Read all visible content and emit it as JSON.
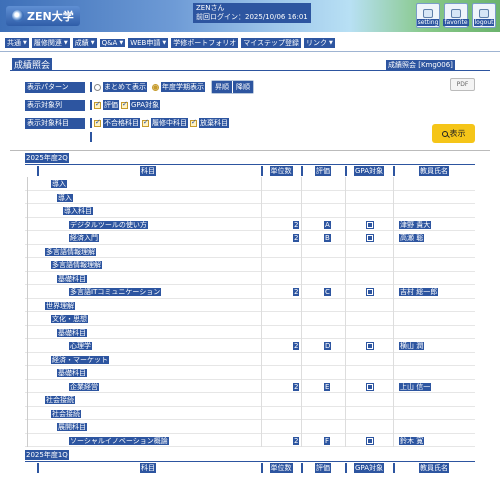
{
  "header": {
    "logo_text": "ZEN大学",
    "user_name": "ZENさん",
    "last_login": "前回ログイン：2025/10/06 16:01",
    "buttons": [
      {
        "label": "setting",
        "icon": "gear-icon"
      },
      {
        "label": "favorite",
        "icon": "star-icon"
      },
      {
        "label": "logout",
        "icon": "logout-icon"
      }
    ]
  },
  "nav": [
    "共通",
    "履修関連",
    "成績",
    "Q&A",
    "WEB申請",
    "学修ポートフォリオ",
    "マイステップ登録",
    "リンク"
  ],
  "page": {
    "title": "成績照会",
    "crumb": "成績照会 [Kmg006]"
  },
  "filter": {
    "pattern_label": "表示パターン",
    "pattern_options": [
      "まとめて表示",
      "年度学期表示"
    ],
    "pattern_selected": "年度学期表示",
    "order_options": [
      "昇順",
      "降順"
    ],
    "columns_label": "表示対象列",
    "column_options": [
      "評価",
      "GPA対象"
    ],
    "subjects_label": "表示対象科目",
    "subject_options": [
      "不合格科目",
      "履修中科目",
      "放棄科目"
    ],
    "pdf_label": "PDF",
    "show_label": "表示"
  },
  "table_headers": [
    "科目",
    "単位数",
    "評価",
    "GPA対象",
    "教員氏名"
  ],
  "terms": [
    {
      "label": "2025年度2Q",
      "rows": [
        {
          "indent": 1,
          "name": "導入"
        },
        {
          "indent": 2,
          "name": "導入"
        },
        {
          "indent": 3,
          "name": "導入科目"
        },
        {
          "indent": 4,
          "name": "デジタルツールの使い方",
          "credits": "2",
          "grade": "A",
          "gpa": true,
          "teacher": "津野 貴大"
        },
        {
          "indent": 4,
          "name": "経済入門",
          "credits": "2",
          "grade": "B",
          "gpa": true,
          "teacher": "高瀬 聡"
        },
        {
          "indent": 0,
          "name": "多言語情報理解"
        },
        {
          "indent": 1,
          "name": "多言語情報理解"
        },
        {
          "indent": 2,
          "name": "基礎科目"
        },
        {
          "indent": 4,
          "name": "多言語ITコミュニケーション",
          "credits": "2",
          "grade": "C",
          "gpa": true,
          "teacher": "吉村 総一郎"
        },
        {
          "indent": 0,
          "name": "世界理解"
        },
        {
          "indent": 1,
          "name": "文化・思想"
        },
        {
          "indent": 2,
          "name": "基礎科目"
        },
        {
          "indent": 4,
          "name": "心理学",
          "credits": "2",
          "grade": "D",
          "gpa": true,
          "teacher": "横山 潤"
        },
        {
          "indent": 1,
          "name": "経済・マーケット"
        },
        {
          "indent": 2,
          "name": "基礎科目"
        },
        {
          "indent": 4,
          "name": "企業経営",
          "credits": "2",
          "grade": "E",
          "gpa": true,
          "teacher": "上山 信一"
        },
        {
          "indent": 0,
          "name": "社会接続"
        },
        {
          "indent": 1,
          "name": "社会接続"
        },
        {
          "indent": 2,
          "name": "展開科目"
        },
        {
          "indent": 4,
          "name": "ソーシャルイノベーション概論",
          "credits": "2",
          "grade": "F",
          "gpa": true,
          "teacher": "鈴木 寛"
        }
      ]
    },
    {
      "label": "2025年度1Q",
      "rows": []
    }
  ]
}
